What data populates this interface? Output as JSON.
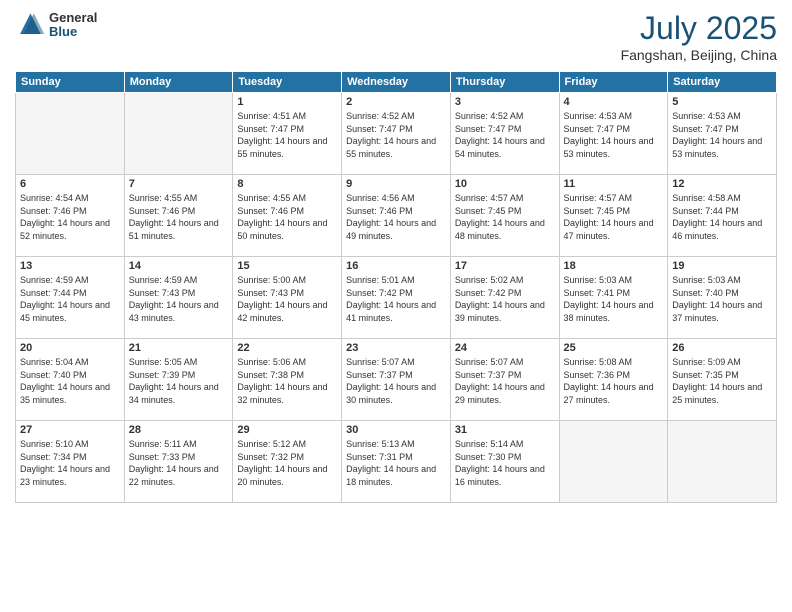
{
  "header": {
    "logo_general": "General",
    "logo_blue": "Blue",
    "month_year": "July 2025",
    "location": "Fangshan, Beijing, China"
  },
  "weekdays": [
    "Sunday",
    "Monday",
    "Tuesday",
    "Wednesday",
    "Thursday",
    "Friday",
    "Saturday"
  ],
  "weeks": [
    [
      {
        "day": "",
        "sunrise": "",
        "sunset": "",
        "daylight": ""
      },
      {
        "day": "",
        "sunrise": "",
        "sunset": "",
        "daylight": ""
      },
      {
        "day": "1",
        "sunrise": "Sunrise: 4:51 AM",
        "sunset": "Sunset: 7:47 PM",
        "daylight": "Daylight: 14 hours and 55 minutes."
      },
      {
        "day": "2",
        "sunrise": "Sunrise: 4:52 AM",
        "sunset": "Sunset: 7:47 PM",
        "daylight": "Daylight: 14 hours and 55 minutes."
      },
      {
        "day": "3",
        "sunrise": "Sunrise: 4:52 AM",
        "sunset": "Sunset: 7:47 PM",
        "daylight": "Daylight: 14 hours and 54 minutes."
      },
      {
        "day": "4",
        "sunrise": "Sunrise: 4:53 AM",
        "sunset": "Sunset: 7:47 PM",
        "daylight": "Daylight: 14 hours and 53 minutes."
      },
      {
        "day": "5",
        "sunrise": "Sunrise: 4:53 AM",
        "sunset": "Sunset: 7:47 PM",
        "daylight": "Daylight: 14 hours and 53 minutes."
      }
    ],
    [
      {
        "day": "6",
        "sunrise": "Sunrise: 4:54 AM",
        "sunset": "Sunset: 7:46 PM",
        "daylight": "Daylight: 14 hours and 52 minutes."
      },
      {
        "day": "7",
        "sunrise": "Sunrise: 4:55 AM",
        "sunset": "Sunset: 7:46 PM",
        "daylight": "Daylight: 14 hours and 51 minutes."
      },
      {
        "day": "8",
        "sunrise": "Sunrise: 4:55 AM",
        "sunset": "Sunset: 7:46 PM",
        "daylight": "Daylight: 14 hours and 50 minutes."
      },
      {
        "day": "9",
        "sunrise": "Sunrise: 4:56 AM",
        "sunset": "Sunset: 7:46 PM",
        "daylight": "Daylight: 14 hours and 49 minutes."
      },
      {
        "day": "10",
        "sunrise": "Sunrise: 4:57 AM",
        "sunset": "Sunset: 7:45 PM",
        "daylight": "Daylight: 14 hours and 48 minutes."
      },
      {
        "day": "11",
        "sunrise": "Sunrise: 4:57 AM",
        "sunset": "Sunset: 7:45 PM",
        "daylight": "Daylight: 14 hours and 47 minutes."
      },
      {
        "day": "12",
        "sunrise": "Sunrise: 4:58 AM",
        "sunset": "Sunset: 7:44 PM",
        "daylight": "Daylight: 14 hours and 46 minutes."
      }
    ],
    [
      {
        "day": "13",
        "sunrise": "Sunrise: 4:59 AM",
        "sunset": "Sunset: 7:44 PM",
        "daylight": "Daylight: 14 hours and 45 minutes."
      },
      {
        "day": "14",
        "sunrise": "Sunrise: 4:59 AM",
        "sunset": "Sunset: 7:43 PM",
        "daylight": "Daylight: 14 hours and 43 minutes."
      },
      {
        "day": "15",
        "sunrise": "Sunrise: 5:00 AM",
        "sunset": "Sunset: 7:43 PM",
        "daylight": "Daylight: 14 hours and 42 minutes."
      },
      {
        "day": "16",
        "sunrise": "Sunrise: 5:01 AM",
        "sunset": "Sunset: 7:42 PM",
        "daylight": "Daylight: 14 hours and 41 minutes."
      },
      {
        "day": "17",
        "sunrise": "Sunrise: 5:02 AM",
        "sunset": "Sunset: 7:42 PM",
        "daylight": "Daylight: 14 hours and 39 minutes."
      },
      {
        "day": "18",
        "sunrise": "Sunrise: 5:03 AM",
        "sunset": "Sunset: 7:41 PM",
        "daylight": "Daylight: 14 hours and 38 minutes."
      },
      {
        "day": "19",
        "sunrise": "Sunrise: 5:03 AM",
        "sunset": "Sunset: 7:40 PM",
        "daylight": "Daylight: 14 hours and 37 minutes."
      }
    ],
    [
      {
        "day": "20",
        "sunrise": "Sunrise: 5:04 AM",
        "sunset": "Sunset: 7:40 PM",
        "daylight": "Daylight: 14 hours and 35 minutes."
      },
      {
        "day": "21",
        "sunrise": "Sunrise: 5:05 AM",
        "sunset": "Sunset: 7:39 PM",
        "daylight": "Daylight: 14 hours and 34 minutes."
      },
      {
        "day": "22",
        "sunrise": "Sunrise: 5:06 AM",
        "sunset": "Sunset: 7:38 PM",
        "daylight": "Daylight: 14 hours and 32 minutes."
      },
      {
        "day": "23",
        "sunrise": "Sunrise: 5:07 AM",
        "sunset": "Sunset: 7:37 PM",
        "daylight": "Daylight: 14 hours and 30 minutes."
      },
      {
        "day": "24",
        "sunrise": "Sunrise: 5:07 AM",
        "sunset": "Sunset: 7:37 PM",
        "daylight": "Daylight: 14 hours and 29 minutes."
      },
      {
        "day": "25",
        "sunrise": "Sunrise: 5:08 AM",
        "sunset": "Sunset: 7:36 PM",
        "daylight": "Daylight: 14 hours and 27 minutes."
      },
      {
        "day": "26",
        "sunrise": "Sunrise: 5:09 AM",
        "sunset": "Sunset: 7:35 PM",
        "daylight": "Daylight: 14 hours and 25 minutes."
      }
    ],
    [
      {
        "day": "27",
        "sunrise": "Sunrise: 5:10 AM",
        "sunset": "Sunset: 7:34 PM",
        "daylight": "Daylight: 14 hours and 23 minutes."
      },
      {
        "day": "28",
        "sunrise": "Sunrise: 5:11 AM",
        "sunset": "Sunset: 7:33 PM",
        "daylight": "Daylight: 14 hours and 22 minutes."
      },
      {
        "day": "29",
        "sunrise": "Sunrise: 5:12 AM",
        "sunset": "Sunset: 7:32 PM",
        "daylight": "Daylight: 14 hours and 20 minutes."
      },
      {
        "day": "30",
        "sunrise": "Sunrise: 5:13 AM",
        "sunset": "Sunset: 7:31 PM",
        "daylight": "Daylight: 14 hours and 18 minutes."
      },
      {
        "day": "31",
        "sunrise": "Sunrise: 5:14 AM",
        "sunset": "Sunset: 7:30 PM",
        "daylight": "Daylight: 14 hours and 16 minutes."
      },
      {
        "day": "",
        "sunrise": "",
        "sunset": "",
        "daylight": ""
      },
      {
        "day": "",
        "sunrise": "",
        "sunset": "",
        "daylight": ""
      }
    ]
  ]
}
